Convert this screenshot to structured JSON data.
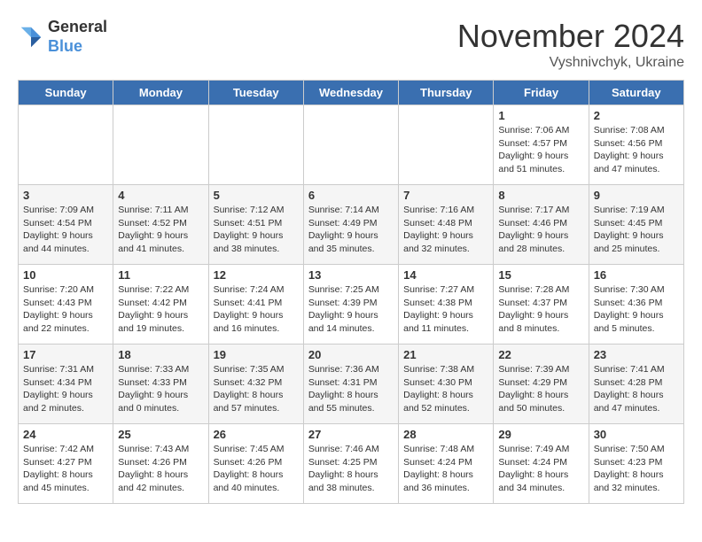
{
  "logo": {
    "general": "General",
    "blue": "Blue"
  },
  "title": "November 2024",
  "location": "Vyshnivchyk, Ukraine",
  "days_of_week": [
    "Sunday",
    "Monday",
    "Tuesday",
    "Wednesday",
    "Thursday",
    "Friday",
    "Saturday"
  ],
  "weeks": [
    [
      {
        "day": "",
        "info": ""
      },
      {
        "day": "",
        "info": ""
      },
      {
        "day": "",
        "info": ""
      },
      {
        "day": "",
        "info": ""
      },
      {
        "day": "",
        "info": ""
      },
      {
        "day": "1",
        "info": "Sunrise: 7:06 AM\nSunset: 4:57 PM\nDaylight: 9 hours and 51 minutes."
      },
      {
        "day": "2",
        "info": "Sunrise: 7:08 AM\nSunset: 4:56 PM\nDaylight: 9 hours and 47 minutes."
      }
    ],
    [
      {
        "day": "3",
        "info": "Sunrise: 7:09 AM\nSunset: 4:54 PM\nDaylight: 9 hours and 44 minutes."
      },
      {
        "day": "4",
        "info": "Sunrise: 7:11 AM\nSunset: 4:52 PM\nDaylight: 9 hours and 41 minutes."
      },
      {
        "day": "5",
        "info": "Sunrise: 7:12 AM\nSunset: 4:51 PM\nDaylight: 9 hours and 38 minutes."
      },
      {
        "day": "6",
        "info": "Sunrise: 7:14 AM\nSunset: 4:49 PM\nDaylight: 9 hours and 35 minutes."
      },
      {
        "day": "7",
        "info": "Sunrise: 7:16 AM\nSunset: 4:48 PM\nDaylight: 9 hours and 32 minutes."
      },
      {
        "day": "8",
        "info": "Sunrise: 7:17 AM\nSunset: 4:46 PM\nDaylight: 9 hours and 28 minutes."
      },
      {
        "day": "9",
        "info": "Sunrise: 7:19 AM\nSunset: 4:45 PM\nDaylight: 9 hours and 25 minutes."
      }
    ],
    [
      {
        "day": "10",
        "info": "Sunrise: 7:20 AM\nSunset: 4:43 PM\nDaylight: 9 hours and 22 minutes."
      },
      {
        "day": "11",
        "info": "Sunrise: 7:22 AM\nSunset: 4:42 PM\nDaylight: 9 hours and 19 minutes."
      },
      {
        "day": "12",
        "info": "Sunrise: 7:24 AM\nSunset: 4:41 PM\nDaylight: 9 hours and 16 minutes."
      },
      {
        "day": "13",
        "info": "Sunrise: 7:25 AM\nSunset: 4:39 PM\nDaylight: 9 hours and 14 minutes."
      },
      {
        "day": "14",
        "info": "Sunrise: 7:27 AM\nSunset: 4:38 PM\nDaylight: 9 hours and 11 minutes."
      },
      {
        "day": "15",
        "info": "Sunrise: 7:28 AM\nSunset: 4:37 PM\nDaylight: 9 hours and 8 minutes."
      },
      {
        "day": "16",
        "info": "Sunrise: 7:30 AM\nSunset: 4:36 PM\nDaylight: 9 hours and 5 minutes."
      }
    ],
    [
      {
        "day": "17",
        "info": "Sunrise: 7:31 AM\nSunset: 4:34 PM\nDaylight: 9 hours and 2 minutes."
      },
      {
        "day": "18",
        "info": "Sunrise: 7:33 AM\nSunset: 4:33 PM\nDaylight: 9 hours and 0 minutes."
      },
      {
        "day": "19",
        "info": "Sunrise: 7:35 AM\nSunset: 4:32 PM\nDaylight: 8 hours and 57 minutes."
      },
      {
        "day": "20",
        "info": "Sunrise: 7:36 AM\nSunset: 4:31 PM\nDaylight: 8 hours and 55 minutes."
      },
      {
        "day": "21",
        "info": "Sunrise: 7:38 AM\nSunset: 4:30 PM\nDaylight: 8 hours and 52 minutes."
      },
      {
        "day": "22",
        "info": "Sunrise: 7:39 AM\nSunset: 4:29 PM\nDaylight: 8 hours and 50 minutes."
      },
      {
        "day": "23",
        "info": "Sunrise: 7:41 AM\nSunset: 4:28 PM\nDaylight: 8 hours and 47 minutes."
      }
    ],
    [
      {
        "day": "24",
        "info": "Sunrise: 7:42 AM\nSunset: 4:27 PM\nDaylight: 8 hours and 45 minutes."
      },
      {
        "day": "25",
        "info": "Sunrise: 7:43 AM\nSunset: 4:26 PM\nDaylight: 8 hours and 42 minutes."
      },
      {
        "day": "26",
        "info": "Sunrise: 7:45 AM\nSunset: 4:26 PM\nDaylight: 8 hours and 40 minutes."
      },
      {
        "day": "27",
        "info": "Sunrise: 7:46 AM\nSunset: 4:25 PM\nDaylight: 8 hours and 38 minutes."
      },
      {
        "day": "28",
        "info": "Sunrise: 7:48 AM\nSunset: 4:24 PM\nDaylight: 8 hours and 36 minutes."
      },
      {
        "day": "29",
        "info": "Sunrise: 7:49 AM\nSunset: 4:24 PM\nDaylight: 8 hours and 34 minutes."
      },
      {
        "day": "30",
        "info": "Sunrise: 7:50 AM\nSunset: 4:23 PM\nDaylight: 8 hours and 32 minutes."
      }
    ]
  ]
}
